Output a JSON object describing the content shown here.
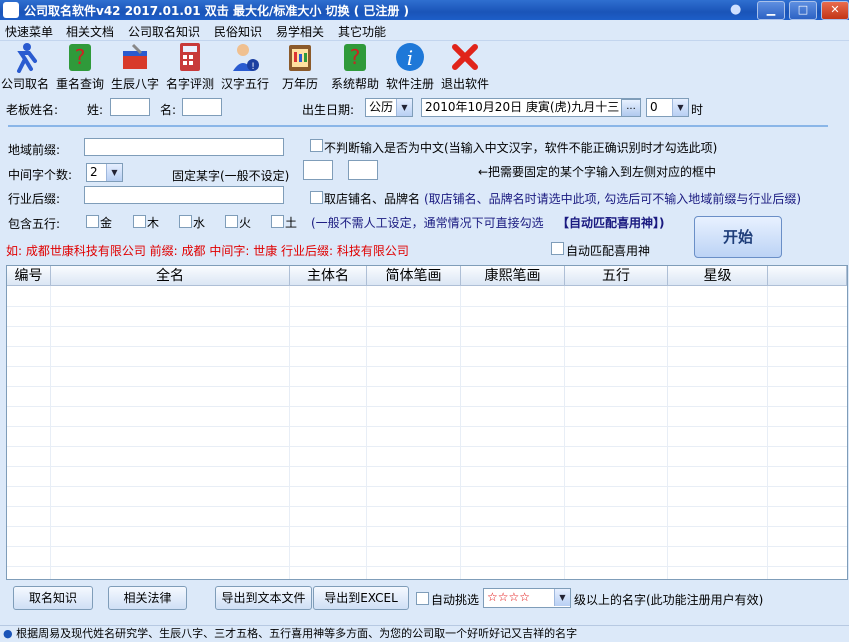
{
  "window": {
    "title": "公司取名软件v42   2017.01.01  双击 最大化/标准大小 切换 ( 已注册 )",
    "controls": [
      "▁",
      "□",
      "✕"
    ]
  },
  "menu": [
    "快速菜单",
    "相关文档",
    "公司取名知识",
    "民俗知识",
    "易学相关",
    "其它功能"
  ],
  "toolbar": [
    {
      "label": "公司取名",
      "icon": "runner-icon"
    },
    {
      "label": "重名查询",
      "icon": "question-book-icon"
    },
    {
      "label": "生辰八字",
      "icon": "toolbox-icon"
    },
    {
      "label": "名字评测",
      "icon": "calculator-icon"
    },
    {
      "label": "汉字五行",
      "icon": "person-info-icon"
    },
    {
      "label": "万年历",
      "icon": "calendar-icon"
    },
    {
      "label": "系统帮助",
      "icon": "help-book-icon"
    },
    {
      "label": "软件注册",
      "icon": "info-icon"
    },
    {
      "label": "退出软件",
      "icon": "close-x-icon"
    }
  ],
  "owner": {
    "label": "老板姓名:",
    "surname_label": "姓:",
    "given_label": "名:",
    "surname": "",
    "given": ""
  },
  "birth": {
    "label": "出生日期:",
    "calendar_type": "公历",
    "date_text": "2010年10月20日 庚寅(虎)九月十三",
    "more_button": "...",
    "hour": "0",
    "hour_label": "时"
  },
  "form": {
    "region_prefix_label": "地域前缀:",
    "region_prefix": "",
    "no_chinese_check_label": "不判断输入是否为中文(当输入中文汉字，软件不能正确识别时才勾选此项)",
    "middle_count_label": "中间字个数:",
    "middle_count": "2",
    "fixed_char_label": "固定某字(一般不设定)",
    "fixed_hint": "←把需要固定的某个字输入到左侧对应的框中",
    "industry_suffix_label": "行业后缀:",
    "industry_suffix": "",
    "shop_brand_label": "取店铺名、品牌名",
    "shop_brand_hint": "(取店铺名、品牌名时请选中此项, 勾选后可不输入地域前缀与行业后缀)",
    "wuxing_label": "包含五行:",
    "wuxing_options": [
      "金",
      "木",
      "水",
      "火",
      "土"
    ],
    "wuxing_hint": "(一般不需人工设定，通常情况下可直接勾选",
    "wuxing_hint2": "【自动匹配喜用神】)",
    "example_text": "如: 成都世康科技有限公司   前缀: 成都   中间字: 世康   行业后缀: 科技有限公司",
    "auto_match_label": "自动匹配喜用神",
    "start_button": "开始"
  },
  "table": {
    "columns": [
      "编号",
      "全名",
      "主体名",
      "简体笔画",
      "康熙笔画",
      "五行",
      "星级"
    ],
    "rows": []
  },
  "bottom": {
    "knowledge_button": "取名知识",
    "law_button": "相关法律",
    "export_text_button": "导出到文本文件",
    "export_excel_button": "导出到EXCEL",
    "auto_pick_label": "自动挑选",
    "star_value": "☆☆☆☆",
    "star_hint": "级以上的名字(此功能注册用户有效)"
  },
  "status": "根据周易及现代姓名研究学、生辰八字、三才五格、五行喜用神等多方面、为您的公司取一个好听好记又吉祥的名字",
  "colors": {
    "title_blue": "#1a54b8",
    "red_text": "#e00000",
    "panel_bg": "#dce9f9"
  }
}
